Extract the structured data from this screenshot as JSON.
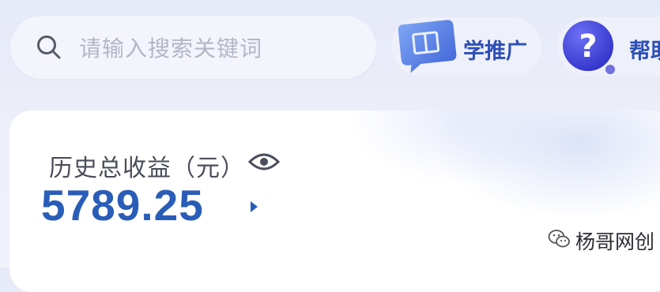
{
  "search": {
    "placeholder": "请输入搜索关键词",
    "icon": "search-icon"
  },
  "header": {
    "learn_label": "学推广",
    "learn_icon": "book-icon",
    "help_label": "帮助",
    "help_icon": "question-icon"
  },
  "earnings": {
    "label": "历史总收益（元）",
    "value": "5789.25",
    "eye_icon": "eye-icon",
    "arrow_icon": "triangle-right-icon"
  },
  "watermark": {
    "text": "杨哥网创",
    "icon": "wechat-icon"
  },
  "colors": {
    "accent": "#2a5db8",
    "label_blue": "#2d4fb6",
    "background": "#e8eaf7",
    "card": "#ffffff"
  }
}
